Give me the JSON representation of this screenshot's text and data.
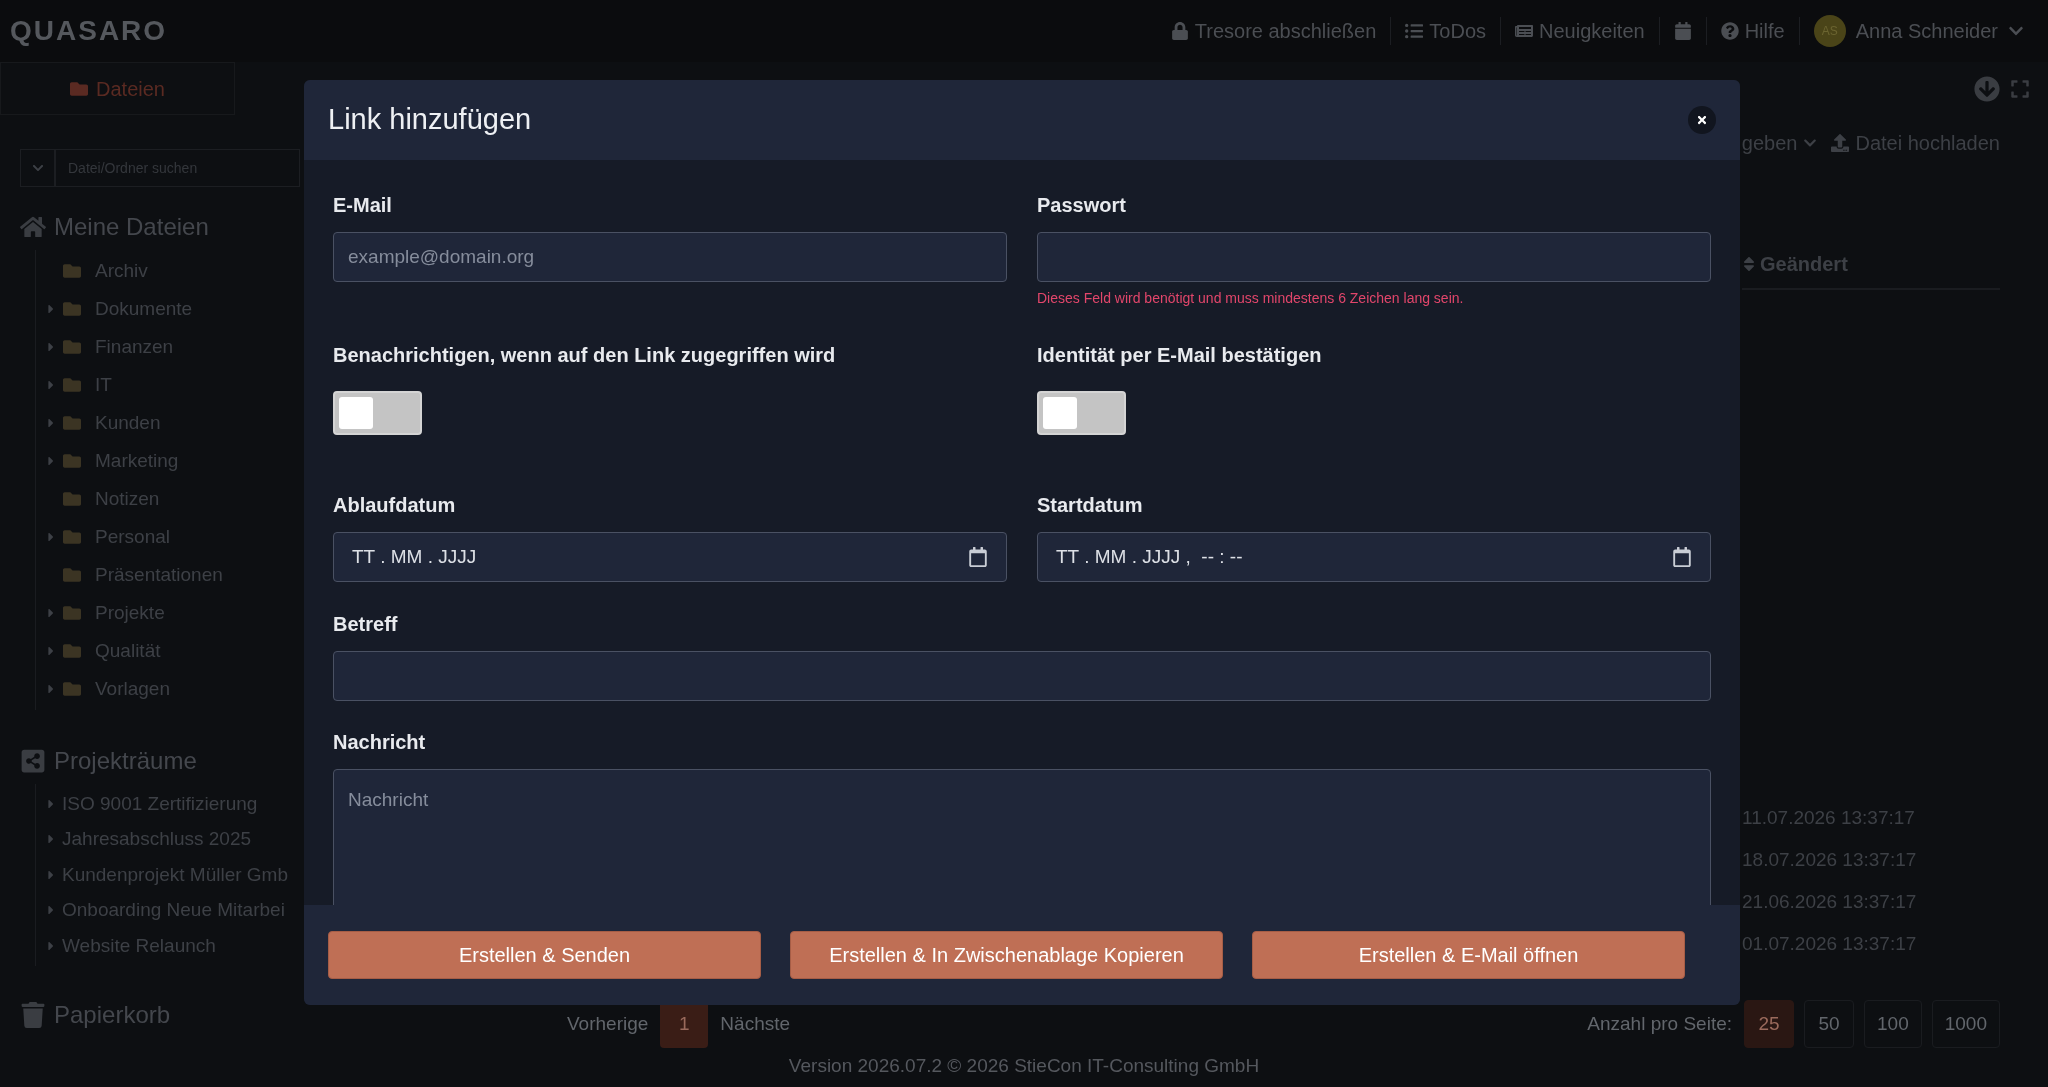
{
  "app": {
    "logo": "QUASARO"
  },
  "top_bar": {
    "items": [
      {
        "kind": "lock",
        "label": "Tresore abschließen"
      },
      {
        "kind": "todo",
        "label": "ToDos"
      },
      {
        "kind": "news",
        "label": "Neuigkeiten"
      },
      {
        "kind": "calendar"
      },
      {
        "kind": "help",
        "label": "Hilfe"
      }
    ],
    "user": {
      "initials": "AS",
      "name": "Anna Schneider"
    }
  },
  "sidebar": {
    "tab": {
      "label": "Dateien"
    },
    "search": {
      "placeholder": "Datei/Ordner suchen"
    },
    "sections": [
      {
        "kind": "home",
        "title": "Meine Dateien",
        "items": [
          {
            "label": "Archiv",
            "expandable": false
          },
          {
            "label": "Dokumente",
            "expandable": true
          },
          {
            "label": "Finanzen",
            "expandable": true
          },
          {
            "label": "IT",
            "expandable": true
          },
          {
            "label": "Kunden",
            "expandable": true
          },
          {
            "label": "Marketing",
            "expandable": true
          },
          {
            "label": "Notizen",
            "expandable": false
          },
          {
            "label": "Personal",
            "expandable": true
          },
          {
            "label": "Präsentationen",
            "expandable": false
          },
          {
            "label": "Projekte",
            "expandable": true
          },
          {
            "label": "Qualität",
            "expandable": true
          },
          {
            "label": "Vorlagen",
            "expandable": true
          }
        ]
      },
      {
        "kind": "share",
        "title": "Projekträume",
        "items": [
          {
            "label": "ISO 9001 Zertifizierung",
            "expandable": true
          },
          {
            "label": "Jahresabschluss 2025",
            "expandable": true
          },
          {
            "label": "Kundenprojekt Müller Gmb",
            "expandable": true
          },
          {
            "label": "Onboarding Neue Mitarbei",
            "expandable": true
          },
          {
            "label": "Website Relaunch",
            "expandable": true
          }
        ]
      },
      {
        "kind": "trash",
        "title": "Papierkorb"
      }
    ]
  },
  "main": {
    "toolbar": [
      {
        "kind": "dropdown",
        "label": "geben"
      },
      {
        "kind": "upload",
        "label": "Datei hochladen"
      }
    ],
    "table": {
      "columns": [
        {
          "label": "Geändert"
        }
      ],
      "rows": [
        {
          "column_1": "11.07.2026 13:37:17"
        },
        {
          "column_1": "18.07.2026 13:37:17"
        },
        {
          "column_1": "21.06.2026 13:37:17"
        },
        {
          "column_1": "01.07.2026 13:37:17"
        }
      ]
    },
    "pagination": {
      "prev": "Vorherige",
      "pages": [
        {
          "label": "1",
          "selected": true
        }
      ],
      "next": "Nächste",
      "per_page_label": "Anzahl pro Seite:",
      "per_page": [
        {
          "label": "25",
          "selected": true
        },
        {
          "label": "50",
          "selected": false
        },
        {
          "label": "100",
          "selected": false
        },
        {
          "label": "1000",
          "selected": false
        }
      ]
    }
  },
  "footer": "Version 2026.07.2 © 2026 StieCon IT-Consulting GmbH",
  "modal": {
    "title": "Link hinzufügen",
    "rows": [
      [
        {
          "kind": "email",
          "label": "E-Mail",
          "placeholder": "example@domain.org"
        },
        {
          "kind": "password",
          "label": "Passwort",
          "error": "Dieses Feld wird benötigt und muss mindestens 6 Zeichen lang sein."
        }
      ],
      [
        {
          "kind": "toggle",
          "label": "Benachrichtigen, wenn auf den Link zugegriffen wird",
          "on": false
        },
        {
          "kind": "toggle",
          "label": "Identität per E-Mail bestätigen",
          "on": false
        }
      ],
      [
        {
          "kind": "date",
          "label": "Ablaufdatum",
          "placeholder": "TT . MM . JJJJ"
        },
        {
          "kind": "date",
          "label": "Startdatum",
          "placeholder": "TT . MM . JJJJ ,  -- : --"
        }
      ],
      [
        {
          "kind": "text",
          "label": "Betreff"
        }
      ],
      [
        {
          "kind": "textarea",
          "label": "Nachricht",
          "placeholder": "Nachricht"
        }
      ]
    ],
    "buttons": [
      "Erstellen & Senden",
      "Erstellen & In Zwischenablage Kopieren",
      "Erstellen & E-Mail öffnen"
    ]
  }
}
